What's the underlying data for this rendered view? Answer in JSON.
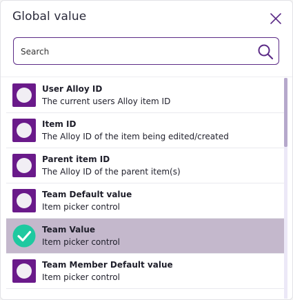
{
  "dialog": {
    "title": "Global value",
    "close_icon": "close-icon"
  },
  "search": {
    "placeholder": "Search",
    "value": "",
    "icon": "search-icon"
  },
  "colors": {
    "accent": "#5b2a86",
    "badge": "#6a1a8a",
    "selected_row": "#c4b8cc",
    "check": "#1ec9a0"
  },
  "items": [
    {
      "name": "User Alloy ID",
      "description": "The current users Alloy item ID",
      "selected": false
    },
    {
      "name": "Item ID",
      "description": "The Alloy ID of the item being edited/created",
      "selected": false
    },
    {
      "name": "Parent item ID",
      "description": "The Alloy ID of the parent item(s)",
      "selected": false
    },
    {
      "name": "Team Default value",
      "description": "Item picker control",
      "selected": false
    },
    {
      "name": "Team Value",
      "description": "Item picker control",
      "selected": true
    },
    {
      "name": "Team Member Default value",
      "description": "Item picker control",
      "selected": false
    }
  ]
}
